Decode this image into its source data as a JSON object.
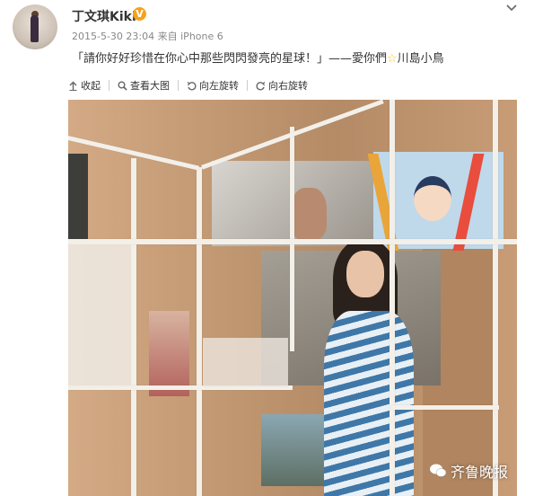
{
  "user": {
    "name": "丁文琪Kiki",
    "verified_badge": "V",
    "timestamp": "2015-5-30 23:04",
    "source_prefix": "来自",
    "source": "iPhone 6"
  },
  "post": {
    "text_before_star": "「請你好好珍惜在你心中那些閃閃發亮的星球！」——愛你們",
    "star": "☆",
    "text_after_star": "川島小鳥"
  },
  "toolbar": {
    "collapse": "收起",
    "view_large": "查看大图",
    "rotate_left": "向左旋转",
    "rotate_right": "向右旋转"
  },
  "watermark": {
    "text": "齐鲁晚报",
    "icon": "wechat-icon"
  },
  "icons": {
    "menu": "chevron-down-icon",
    "collapse": "arrow-up-icon",
    "view_large": "magnifier-icon",
    "rotate_left": "rotate-left-icon",
    "rotate_right": "rotate-right-icon"
  },
  "colors": {
    "badge": "#f5a31a",
    "text": "#333333",
    "meta": "#888888"
  }
}
